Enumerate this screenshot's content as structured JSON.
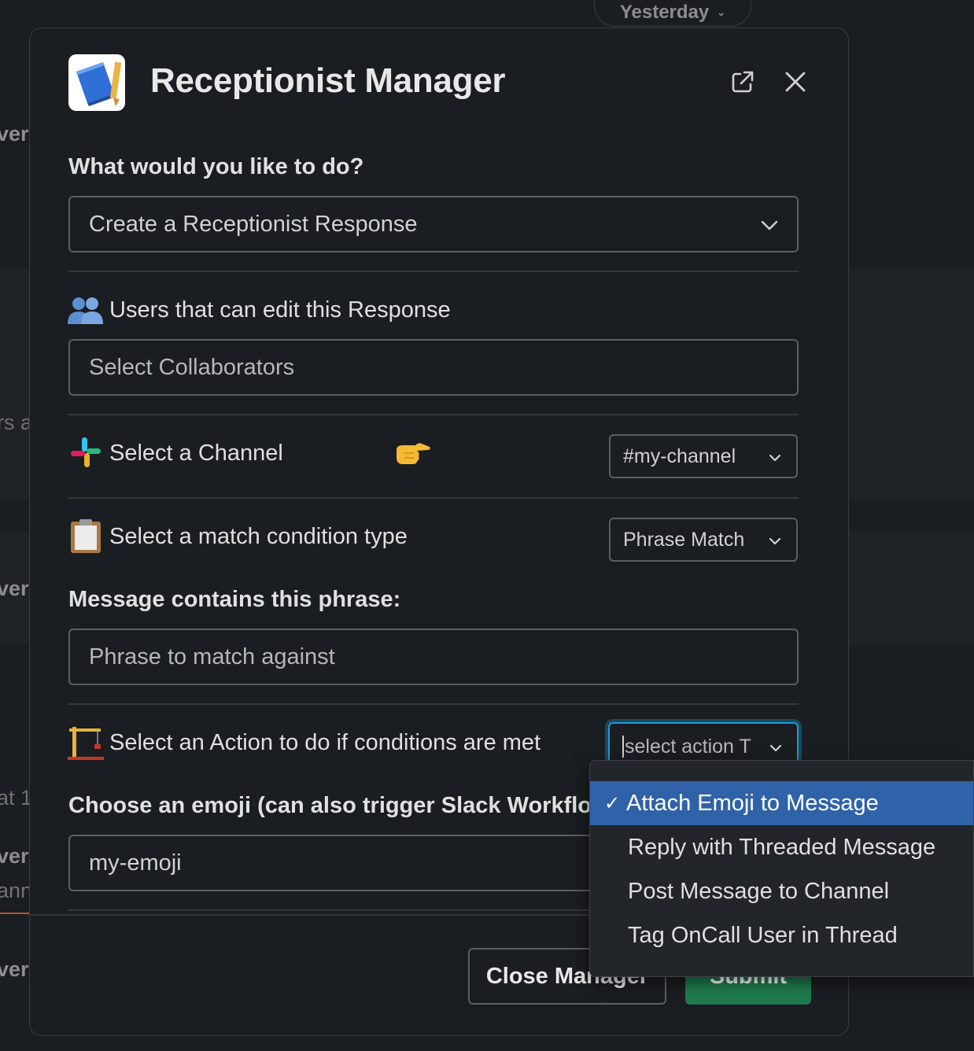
{
  "background": {
    "date_pill": "Yesterday",
    "fragments": [
      "verl",
      "rs ag",
      "verl",
      "at 1",
      "verl",
      "ann",
      "verl"
    ]
  },
  "modal": {
    "title": "Receptionist Manager",
    "icons": {
      "app": "notebook-icon",
      "open_external": "external-link-icon",
      "close": "close-icon"
    },
    "action_label": "What would you like to do?",
    "action_value": "Create a Receptionist Response",
    "collaborators": {
      "emoji": "busts-in-silhouette",
      "label": "Users that can edit this Response",
      "placeholder": "Select Collaborators"
    },
    "channel": {
      "emoji": "slack-logo",
      "label": "Select a Channel",
      "pointer_emoji": "pointing-right",
      "value": "#my-channel"
    },
    "match_condition": {
      "emoji": "clipboard",
      "label": "Select a match condition type",
      "value": "Phrase Match"
    },
    "phrase": {
      "label": "Message contains this phrase:",
      "placeholder": "Phrase to match against"
    },
    "action_select": {
      "emoji": "construction-crane",
      "label": "Select an Action to do if conditions are met",
      "value": "select action T"
    },
    "emoji_choice": {
      "label": "Choose an emoji (can also trigger Slack Workflows",
      "value": "my-emoji"
    },
    "buttons": {
      "close": "Close Manager",
      "submit": "Submit"
    }
  },
  "dropdown": {
    "options": [
      {
        "label": "Attach Emoji to Message",
        "selected": true
      },
      {
        "label": "Reply with Threaded Message",
        "selected": false
      },
      {
        "label": "Post Message to Channel",
        "selected": false
      },
      {
        "label": "Tag OnCall User in Thread",
        "selected": false
      }
    ],
    "check": "✓"
  },
  "colors": {
    "submit": "#1f7a4d",
    "selected_option": "#2f62a8",
    "focus": "#1d9bd1"
  }
}
